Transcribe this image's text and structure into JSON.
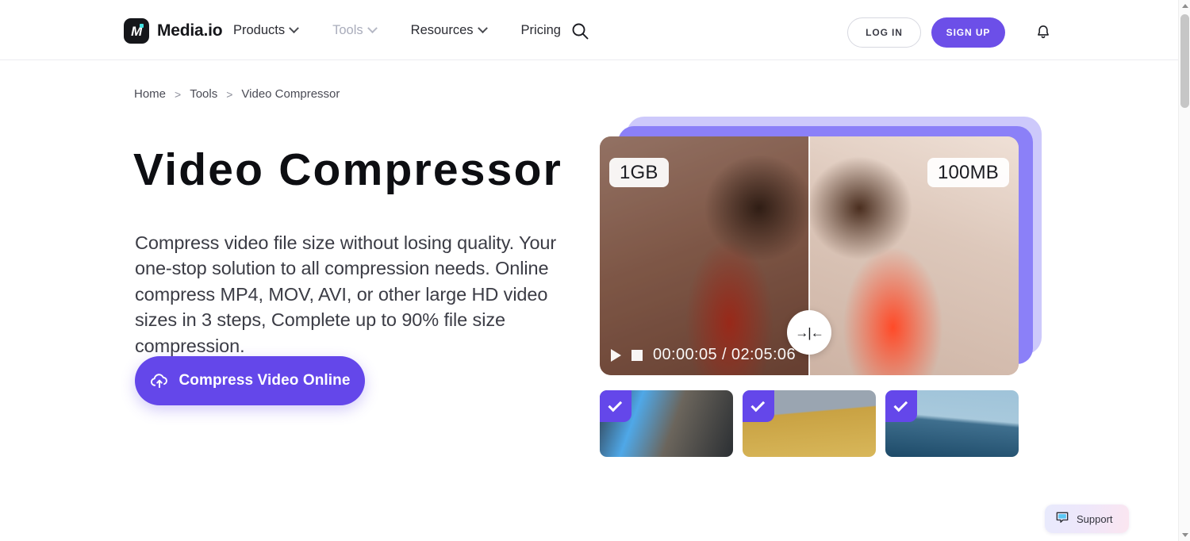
{
  "theme": {
    "accent_purple": "#6447ea",
    "signup_purple": "#6c4fe8",
    "card_layer_outer": "#cdc9fb",
    "card_layer_inner": "#8b80f8",
    "text_dark": "#0d0e12",
    "logo_accent": "#43e0e0"
  },
  "header": {
    "brand": {
      "name": "Media.io",
      "logo_letter": "M",
      "icon": "media-io-logo-icon"
    },
    "nav": [
      {
        "label": "Products",
        "has_dropdown": true,
        "state": "default"
      },
      {
        "label": "Tools",
        "has_dropdown": true,
        "state": "active"
      },
      {
        "label": "Resources",
        "has_dropdown": true,
        "state": "default"
      },
      {
        "label": "Pricing",
        "has_dropdown": false,
        "state": "default"
      }
    ],
    "search_icon": "search-icon",
    "login_label": "LOG IN",
    "signup_label": "SIGN UP",
    "notification_icon": "bell-icon"
  },
  "breadcrumb": {
    "separator": ">",
    "items": [
      {
        "label": "Home",
        "current": false
      },
      {
        "label": "Tools",
        "current": false
      },
      {
        "label": "Video Compressor",
        "current": true
      }
    ]
  },
  "hero": {
    "title": "Video Compressor",
    "description": "Compress video file size without losing quality. Your one-stop solution to all compression needs. Online compress MP4, MOV, AVI, or other large HD video sizes in 3 steps, Complete up to 90% file size compression.",
    "cta": {
      "label": "Compress Video Online",
      "icon": "cloud-upload-icon"
    }
  },
  "preview": {
    "badge_original": "1GB",
    "badge_compressed": "100MB",
    "compare_handle_glyph": "→|←",
    "compare_handle_name": "compare-slider-handle",
    "player": {
      "play_icon": "play-icon",
      "stop_icon": "stop-icon",
      "time_current": "00:00:05",
      "time_separator": "/",
      "time_total": "02:05:06",
      "timestamp": "00:00:05 / 02:05:06"
    },
    "thumbnails": [
      {
        "id": "thumb-1",
        "selected": true
      },
      {
        "id": "thumb-2",
        "selected": true
      },
      {
        "id": "thumb-3",
        "selected": true
      }
    ]
  },
  "support_widget": {
    "label": "Support",
    "icon": "chat-bubble-icon"
  },
  "scrollbar": {
    "orientation": "vertical",
    "position": "near-top"
  }
}
